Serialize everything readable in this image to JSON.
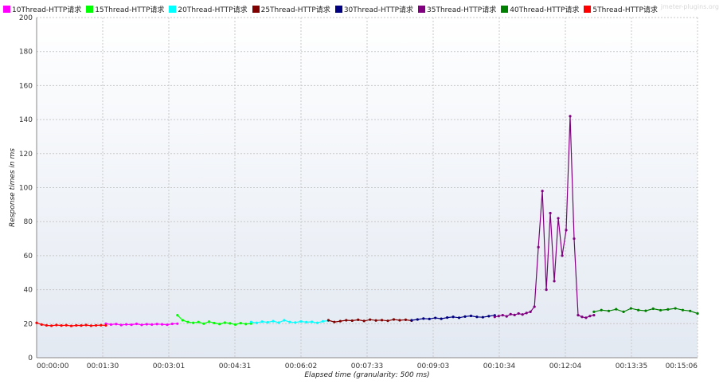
{
  "watermark": "jmeter-plugins.org",
  "colors": {
    "plot_bg_top": "#ffffff",
    "plot_bg_bottom": "#e3e9f2",
    "grid": "#c8c8c8"
  },
  "chart_data": {
    "type": "line",
    "xlabel": "Elapsed time (granularity: 500 ms)",
    "ylabel": "Response times in ms",
    "ylim": [
      0,
      200
    ],
    "xlim_seconds": [
      0,
      906
    ],
    "grid": true,
    "legend_position": "top-left",
    "x_tick_labels": [
      "00:00:00",
      "00:01:30",
      "00:03:01",
      "00:04:31",
      "00:06:02",
      "00:07:33",
      "00:09:03",
      "00:10:34",
      "00:12:04",
      "00:13:35",
      "00:15:06"
    ],
    "y_tick_labels": [
      "0",
      "20",
      "40",
      "60",
      "80",
      "100",
      "120",
      "140",
      "160",
      "180",
      "200"
    ],
    "series": [
      {
        "name": "10Thread-HTTP请求",
        "color": "#ff00ff",
        "x_range_seconds": [
          95,
          193
        ],
        "points_ms": [
          20,
          19.5,
          19.8,
          19.2,
          19.6,
          19.4,
          19.9,
          19.3,
          19.7,
          19.5,
          19.8,
          19.6,
          19.4,
          19.9,
          20
        ]
      },
      {
        "name": "15Thread-HTTP请求",
        "color": "#00ff00",
        "x_range_seconds": [
          193,
          294
        ],
        "points_ms": [
          25,
          22,
          21,
          20.5,
          21,
          20,
          21.2,
          20.4,
          19.8,
          20.6,
          20.2,
          19.5,
          20.3,
          19.8,
          20.1
        ]
      },
      {
        "name": "20Thread-HTTP请求",
        "color": "#00ffff",
        "x_range_seconds": [
          294,
          400
        ],
        "points_ms": [
          21,
          20.5,
          21.2,
          20.8,
          21.5,
          20.6,
          22,
          21,
          20.7,
          21.3,
          20.9,
          21.1,
          20.5,
          21.4,
          21.8
        ]
      },
      {
        "name": "25Thread-HTTP请求",
        "color": "#800000",
        "x_range_seconds": [
          400,
          514
        ],
        "points_ms": [
          22,
          21,
          21.5,
          22,
          21.8,
          22.3,
          21.6,
          22.4,
          21.9,
          22.1,
          21.7,
          22.5,
          22,
          22.3,
          21.8
        ]
      },
      {
        "name": "30Thread-HTTP请求",
        "color": "#000080",
        "x_range_seconds": [
          514,
          628
        ],
        "points_ms": [
          22,
          22.5,
          23,
          22.8,
          23.4,
          22.9,
          23.6,
          24,
          23.5,
          24.2,
          24.6,
          24,
          23.8,
          24.4,
          24.9
        ]
      },
      {
        "name": "35Thread-HTTP请求",
        "color": "#800080",
        "x_range_seconds": [
          628,
          764
        ],
        "points_ms": [
          24,
          24.5,
          25,
          24.3,
          25.6,
          25.1,
          26,
          25.4,
          26.3,
          27,
          30,
          65,
          98,
          40,
          85,
          45,
          82,
          60,
          75,
          142,
          70,
          25,
          24,
          23.5,
          24.5,
          25
        ]
      },
      {
        "name": "40Thread-HTTP请求",
        "color": "#008000",
        "x_range_seconds": [
          764,
          906
        ],
        "points_ms": [
          27,
          28,
          27.5,
          28.5,
          27,
          29,
          28,
          27.6,
          28.8,
          27.9,
          28.4,
          29,
          28,
          27.5,
          26
        ]
      },
      {
        "name": "5Thread-HTTP请求",
        "color": "#ff0000",
        "x_range_seconds": [
          0,
          95
        ],
        "points_ms": [
          20.5,
          19.5,
          19,
          18.8,
          19.2,
          18.9,
          19.1,
          18.7,
          19,
          18.9,
          19.2,
          18.8,
          19,
          19.1,
          19
        ]
      }
    ]
  }
}
